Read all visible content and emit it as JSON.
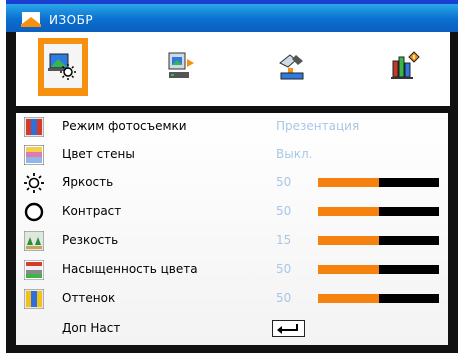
{
  "window": {
    "title": "ИЗОБР"
  },
  "tabs": [
    {
      "icon": "image-settings-icon",
      "selected": true
    },
    {
      "icon": "display-settings-icon",
      "selected": false
    },
    {
      "icon": "setup-settings-icon",
      "selected": false
    },
    {
      "icon": "options-info-icon",
      "selected": false
    }
  ],
  "menu": {
    "items": [
      {
        "label": "Режим фотосъемки",
        "value": "Презентация",
        "icon": "display-mode-icon"
      },
      {
        "label": "Цвет стены",
        "value": "Выкл.",
        "icon": "wall-color-icon"
      },
      {
        "label": "Яркость",
        "value": "50",
        "level": 0.5,
        "icon": "brightness-icon"
      },
      {
        "label": "Контраст",
        "value": "50",
        "level": 0.5,
        "icon": "contrast-icon"
      },
      {
        "label": "Резкость",
        "value": "15",
        "level": 0.5,
        "icon": "sharpness-icon"
      },
      {
        "label": "Насыщенность цвета",
        "value": "50",
        "level": 0.5,
        "icon": "color-saturation-icon"
      },
      {
        "label": "Оттенок",
        "value": "50",
        "level": 0.5,
        "icon": "tint-icon"
      },
      {
        "label": "Доп Наст",
        "icon": "enter-icon"
      }
    ]
  },
  "colors": {
    "accent": "#f5820f",
    "value_text": "#a9c6e6",
    "title_bar": "#0a6fcf"
  }
}
